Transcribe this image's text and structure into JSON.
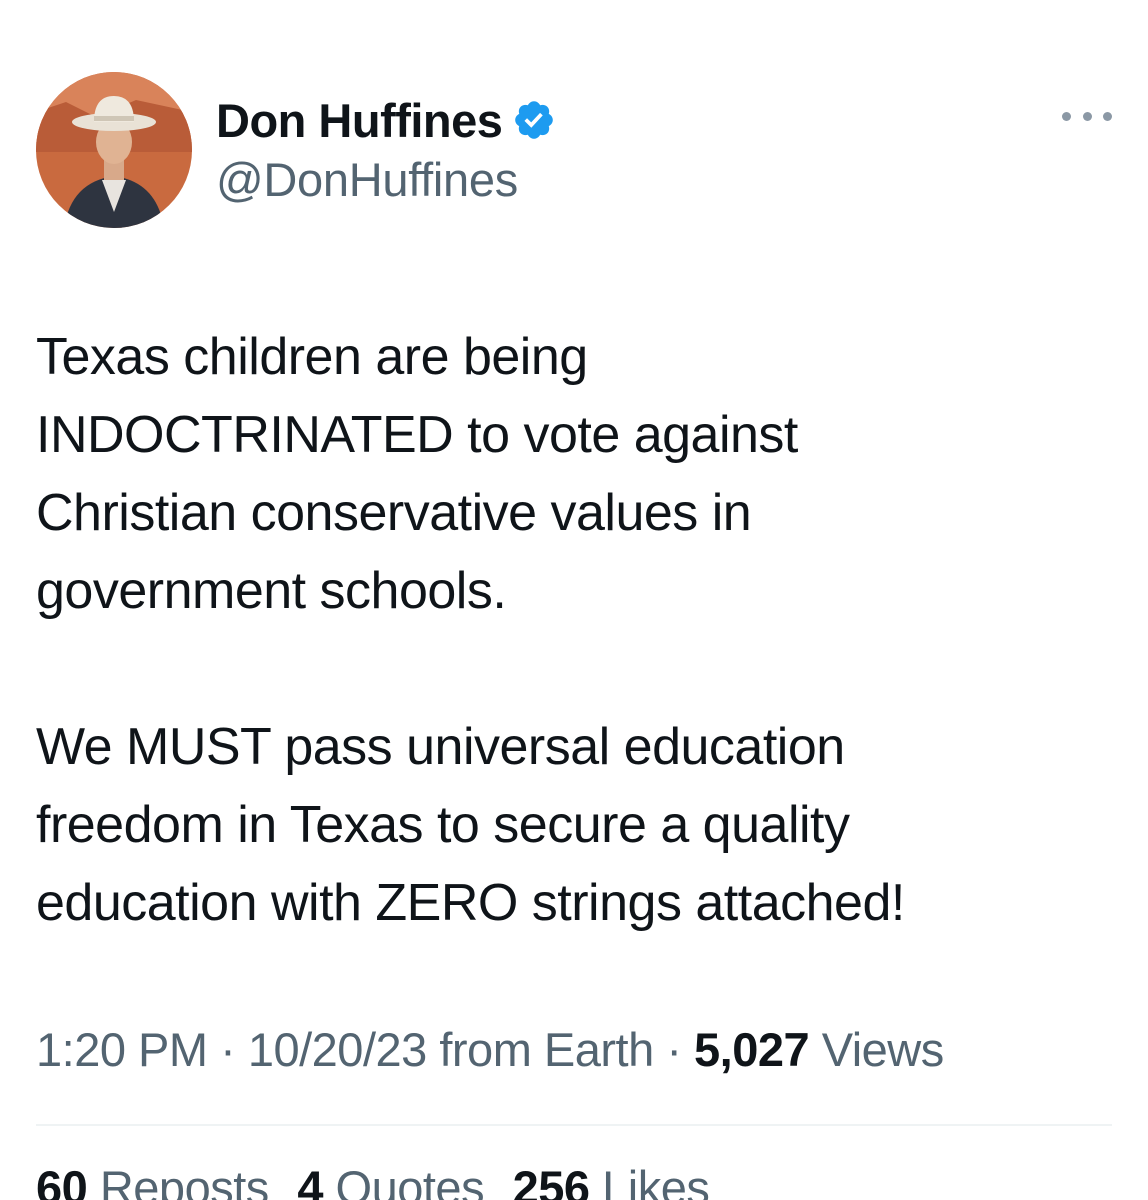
{
  "author": {
    "display_name": "Don Huffines",
    "handle": "@DonHuffines",
    "verified_icon": "verified-badge-icon",
    "verified_color": "#1d9bf0"
  },
  "more_icon": "more-horizontal-icon",
  "tweet": {
    "paragraph_1": "Texas children are being\nINDOCTRINATED to vote against\nChristian conservative values in\ngovernment schools.",
    "paragraph_2": "We MUST pass universal education\nfreedom in Texas to secure a quality\neducation with ZERO strings attached!"
  },
  "meta": {
    "time": "1:20 PM",
    "separator": "·",
    "date": "10/20/23",
    "source": "from Earth",
    "views_count": "5,027",
    "views_label": "Views"
  },
  "stats": {
    "reposts_count": "60",
    "reposts_label": "Reposts",
    "quotes_count": "4",
    "quotes_label": "Quotes",
    "likes_count": "256",
    "likes_label": "Likes"
  }
}
